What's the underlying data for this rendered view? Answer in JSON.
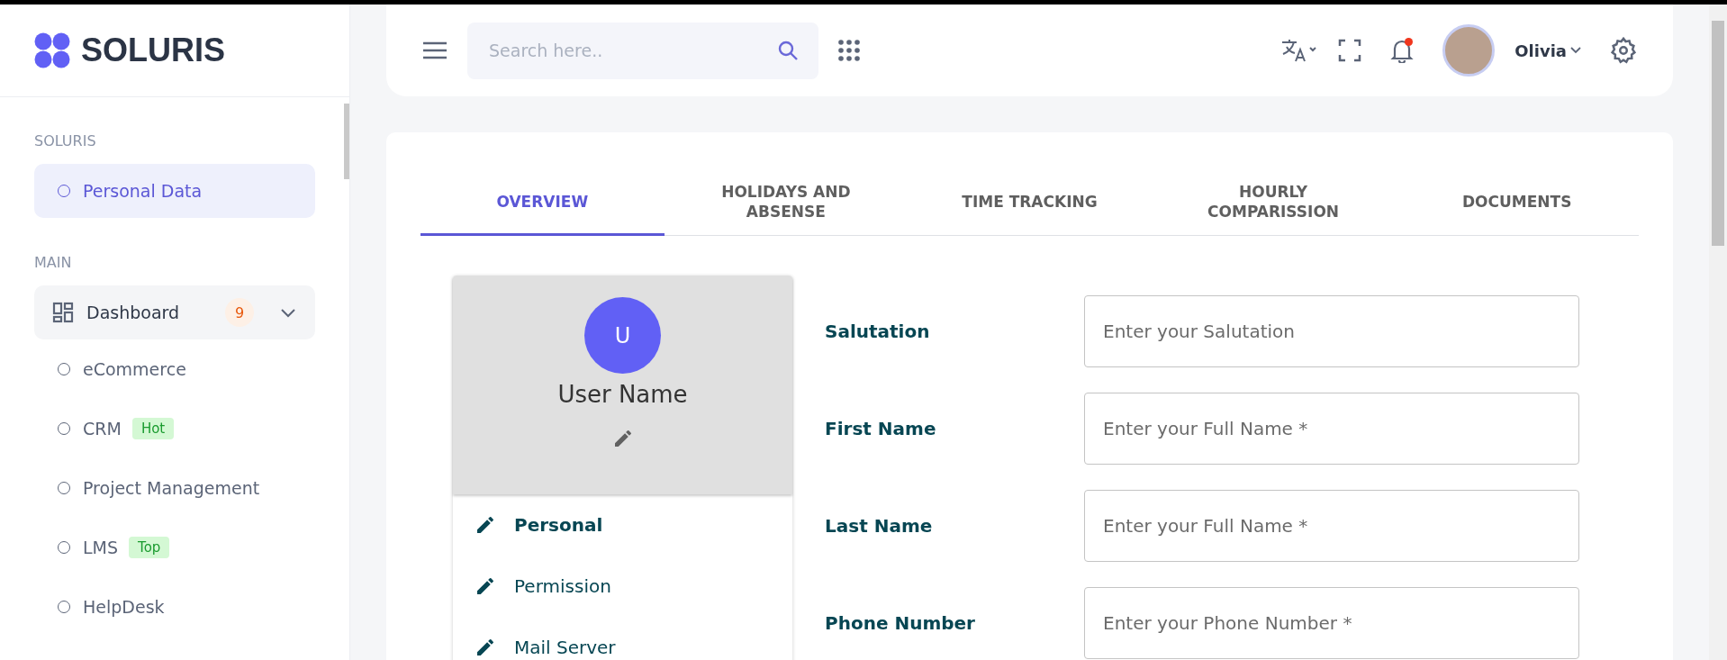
{
  "brand": {
    "name": "SOLURIS"
  },
  "sidebar": {
    "sections": [
      {
        "title": "SOLURIS",
        "items": [
          {
            "label": "Personal Data",
            "kind": "link",
            "selected": true
          }
        ]
      },
      {
        "title": "MAIN",
        "items": [
          {
            "label": "Dashboard",
            "kind": "group",
            "selected": false,
            "expanded": true,
            "count": "9",
            "children": [
              {
                "label": "eCommerce",
                "selected": false
              },
              {
                "label": "CRM",
                "selected": false,
                "badge": "Hot"
              },
              {
                "label": "Project Management",
                "selected": false
              },
              {
                "label": "LMS",
                "selected": false,
                "badge": "Top"
              },
              {
                "label": "HelpDesk",
                "selected": false
              }
            ]
          }
        ]
      }
    ]
  },
  "header": {
    "search": {
      "placeholder": "Search here.."
    },
    "user": {
      "name": "Olivia"
    },
    "notifications": {
      "unread": true
    }
  },
  "tabs": [
    {
      "label": "OVERVIEW",
      "selected": true
    },
    {
      "label": "HOLIDAYS AND ABSENSE",
      "selected": false
    },
    {
      "label": "TIME TRACKING",
      "selected": false
    },
    {
      "label": "HOURLY COMPARISSION",
      "selected": false
    },
    {
      "label": "DOCUMENTS",
      "selected": false
    }
  ],
  "profile": {
    "initial": "U",
    "name": "User Name"
  },
  "profile_menu": [
    {
      "label": "Personal",
      "selected": true
    },
    {
      "label": "Permission",
      "selected": false
    },
    {
      "label": "Mail Server",
      "selected": false
    }
  ],
  "form": [
    {
      "label": "Salutation",
      "placeholder": "Enter your Salutation"
    },
    {
      "label": "First Name",
      "placeholder": "Enter your Full Name *"
    },
    {
      "label": "Last Name",
      "placeholder": "Enter your Full Name *"
    },
    {
      "label": "Phone Number",
      "placeholder": "Enter your Phone Number *"
    }
  ]
}
